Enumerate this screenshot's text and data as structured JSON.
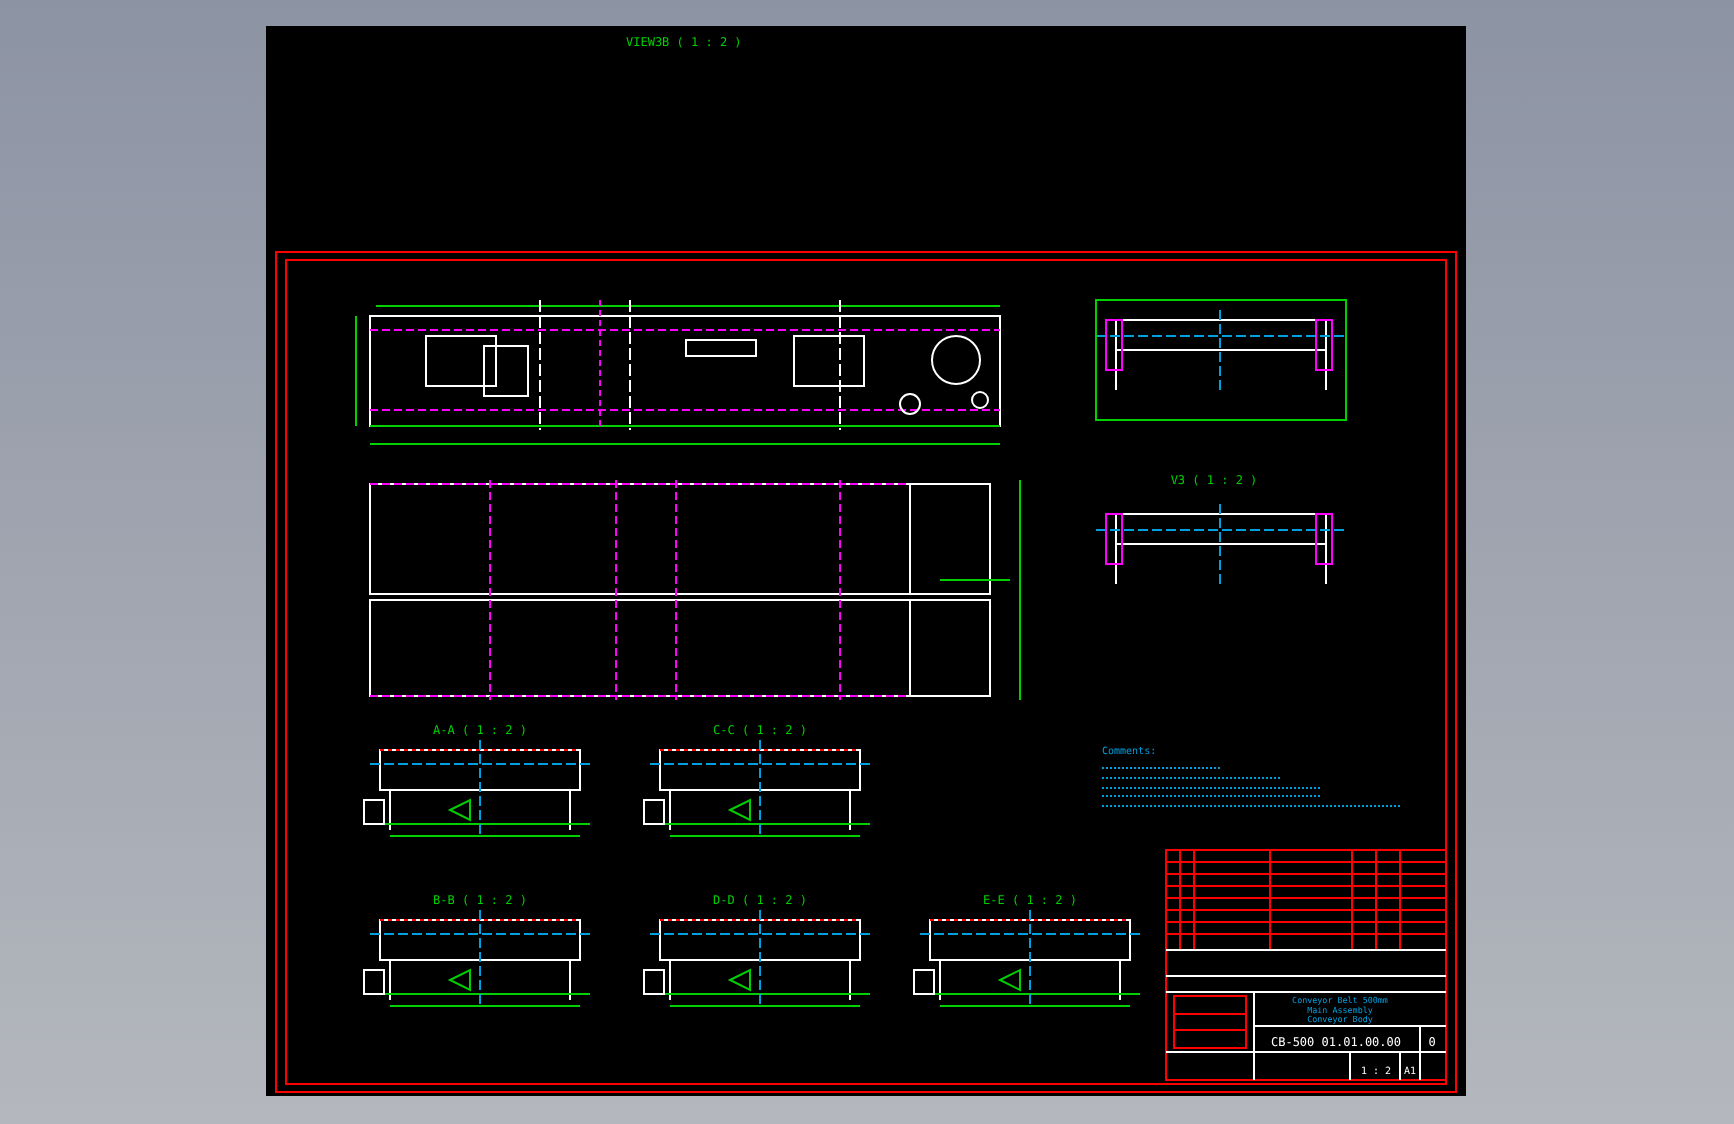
{
  "header_view_label": "VIEW3B ( 1 : 2 )",
  "side_view_label": "V3 ( 1 : 2 )",
  "section_labels": [
    "A-A ( 1 : 2 )",
    "C-C ( 1 : 2 )",
    "B-B ( 1 : 2 )",
    "D-D ( 1 : 2 )",
    "E-E ( 1 : 2 )"
  ],
  "notes": {
    "heading": "Comments:"
  },
  "title_block": {
    "title_lines": [
      "Conveyor Belt 500mm",
      "Main Assembly",
      "Conveyor Body"
    ],
    "drawing_number": "CB-500 01.01.00.00",
    "revision": "0",
    "scale": "1 : 2",
    "sheet_size": "A1"
  }
}
